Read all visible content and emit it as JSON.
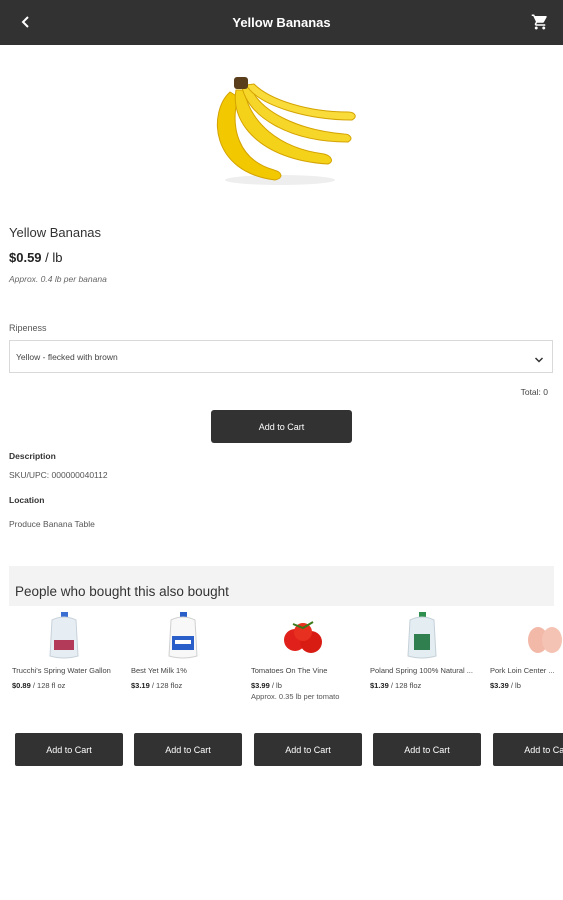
{
  "header": {
    "title": "Yellow Bananas",
    "back_icon": "back-chevron-icon",
    "cart_icon": "shopping-cart-icon"
  },
  "product": {
    "name": "Yellow Bananas",
    "price": "$0.59",
    "unit": "/ lb",
    "approx": "Approx. 0.4 lb per banana",
    "ripeness_label": "Ripeness",
    "ripeness_value": "Yellow - flecked with brown",
    "total": "Total: 0",
    "add_to_cart": "Add to Cart",
    "description_label": "Description",
    "sku": "SKU/UPC: 000000040112",
    "location_label": "Location",
    "location": "Produce Banana Table"
  },
  "recommendations": {
    "title": "People who bought this also bought",
    "items": [
      {
        "name": "Trucchi's Spring Water Gallon",
        "price": "$0.89",
        "unit": "/ 128 fl oz",
        "approx": "",
        "button": "Add to Cart",
        "image": "water-jug"
      },
      {
        "name": "Best Yet Milk 1%",
        "price": "$3.19",
        "unit": "/ 128 floz",
        "approx": "",
        "button": "Add to Cart",
        "image": "milk-jug"
      },
      {
        "name": "Tomatoes On The Vine",
        "price": "$3.99",
        "unit": "/ lb",
        "approx": "Approx. 0.35 lb per tomato",
        "button": "Add to Cart",
        "image": "tomatoes"
      },
      {
        "name": "Poland Spring 100% Natural ...",
        "price": "$1.39",
        "unit": "/ 128 floz",
        "approx": "",
        "button": "Add to Cart",
        "image": "water-jug"
      },
      {
        "name": "Pork Loin Center ...",
        "price": "$3.39",
        "unit": "/ lb",
        "approx": "",
        "button": "Add to Cart",
        "image": "pork-loin"
      }
    ]
  },
  "colors": {
    "topbar": "#323232",
    "button": "#323232",
    "band": "#f3f3f3"
  }
}
